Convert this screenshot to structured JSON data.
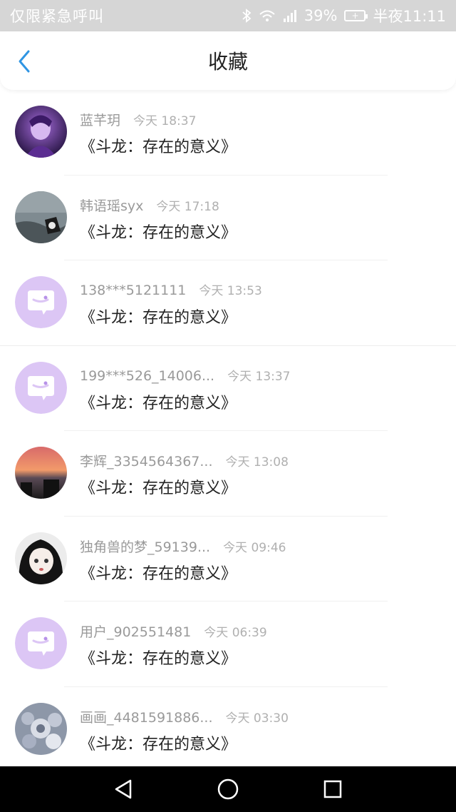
{
  "status_bar": {
    "carrier": "仅限紧急呼叫",
    "battery": "39%",
    "time": "半夜11:11",
    "icons": [
      "bluetooth-icon",
      "wifi-icon",
      "signal-icon",
      "battery-icon"
    ]
  },
  "header": {
    "title": "收藏",
    "back_icon": "chevron-left-icon",
    "accent": "#2f95e3"
  },
  "items": [
    {
      "name": "蓝芊玥",
      "time": "今天 18:37",
      "message": "《斗龙：存在的意义》",
      "avatar": "photo-purple-character"
    },
    {
      "name": "韩语瑶syx",
      "time": "今天 17:18",
      "message": "《斗龙：存在的意义》",
      "avatar": "photo-water"
    },
    {
      "name": "138***5121111",
      "time": "今天 13:53",
      "message": "《斗龙：存在的意义》",
      "avatar": "default-chat-icon"
    },
    {
      "name": "199***526_14006...",
      "time": "今天 13:37",
      "message": "《斗龙：存在的意义》",
      "avatar": "default-chat-icon"
    },
    {
      "name": "李辉_3354564367...",
      "time": "今天 13:08",
      "message": "《斗龙：存在的意义》",
      "avatar": "photo-sunset"
    },
    {
      "name": "独角兽的梦_59139...",
      "time": "今天 09:46",
      "message": "《斗龙：存在的意义》",
      "avatar": "photo-anime-girl"
    },
    {
      "name": "用户_902551481",
      "time": "今天 06:39",
      "message": "《斗龙：存在的意义》",
      "avatar": "default-chat-icon"
    },
    {
      "name": "画画_4481591886...",
      "time": "今天 03:30",
      "message": "《斗龙：存在的意义》",
      "avatar": "photo-flowers"
    }
  ],
  "nav": [
    "back-triangle-icon",
    "home-circle-icon",
    "recents-square-icon"
  ]
}
